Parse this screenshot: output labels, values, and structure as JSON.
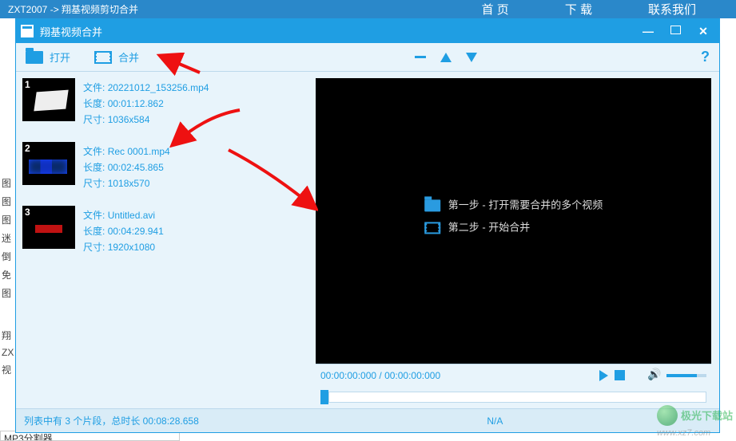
{
  "outer": {
    "breadcrumb": "ZXT2007 -> 翔基视频剪切合并",
    "nav": {
      "home": "首 页",
      "download": "下 载",
      "contact": "联系我们"
    }
  },
  "window": {
    "title": "翔基视频合并"
  },
  "toolbar": {
    "open": "打开",
    "merge": "合并"
  },
  "clips": [
    {
      "num": "1",
      "file_label": "文件:",
      "file": "20221012_153256.mp4",
      "len_label": "长度:",
      "len": "00:01:12.862",
      "size_label": "尺寸:",
      "size": "1036x584"
    },
    {
      "num": "2",
      "file_label": "文件:",
      "file": "Rec 0001.mp4",
      "len_label": "长度:",
      "len": "00:02:45.865",
      "size_label": "尺寸:",
      "size": "1018x570"
    },
    {
      "num": "3",
      "file_label": "文件:",
      "file": "Untitled.avi",
      "len_label": "长度:",
      "len": "00:04:29.941",
      "size_label": "尺寸:",
      "size": "1920x1080"
    }
  ],
  "player": {
    "step1": "第一步 - 打开需要合并的多个视频",
    "step2": "第二步 - 开始合并",
    "time": "00:00:00:000 / 00:00:00:000"
  },
  "status": {
    "left": "列表中有 3 个片段，总时长 00:08:28.658",
    "right": "N/A"
  },
  "side_items": [
    "图",
    "图",
    "图",
    "迷",
    "倒",
    "免",
    "图",
    "",
    "",
    "翔",
    "ZX",
    "视"
  ],
  "below": "MP3分割器",
  "watermark": {
    "brand": "极光下载站",
    "url": "www.xz7.com"
  }
}
